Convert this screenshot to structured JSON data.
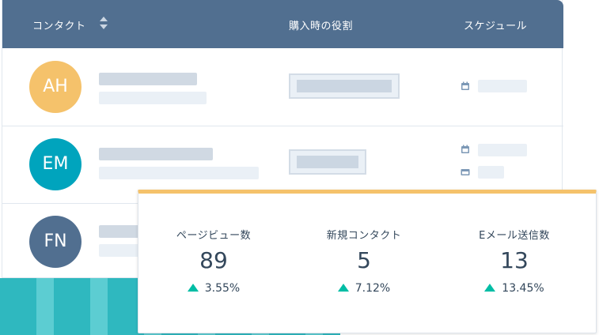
{
  "header": {
    "contact": "コンタクト",
    "role": "購入時の役割",
    "schedule": "スケジュール"
  },
  "contacts": [
    {
      "initials": "AH",
      "color": "#f5c26b"
    },
    {
      "initials": "EM",
      "color": "#00a4bd"
    },
    {
      "initials": "FN",
      "color": "#516f90"
    }
  ],
  "stats": [
    {
      "label": "ページビュー数",
      "value": "89",
      "delta": "3.55%"
    },
    {
      "label": "新規コンタクト",
      "value": "5",
      "delta": "7.12%"
    },
    {
      "label": "Eメール送信数",
      "value": "13",
      "delta": "13.45%"
    }
  ],
  "colors": {
    "header_bg": "#516f90",
    "accent_up": "#00bda5",
    "card_top": "#f5c26b"
  },
  "icons": [
    "sort-icon",
    "calendar-icon",
    "email-icon",
    "trend-up-icon"
  ]
}
